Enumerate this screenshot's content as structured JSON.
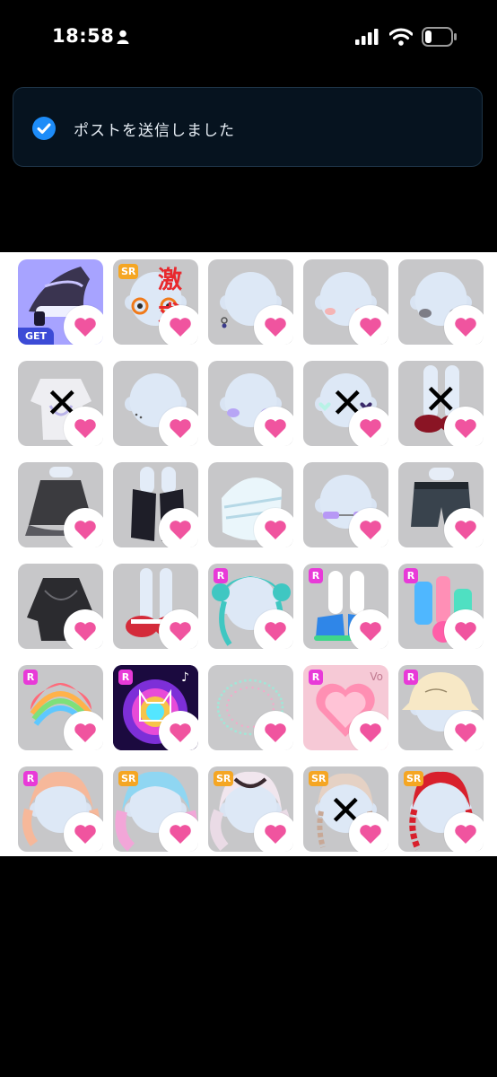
{
  "status_bar": {
    "time": "18:58",
    "icons": [
      "person-icon",
      "signal-icon",
      "wifi-icon",
      "battery-icon"
    ]
  },
  "toast": {
    "message": "ポストを送信しました",
    "icon": "check-circle-icon",
    "accent": "#1d8cf8"
  },
  "colors": {
    "heart": "#f0549f",
    "rarity_r": "#e83ad8",
    "rarity_sr": "#f5a623"
  },
  "items": [
    {
      "kind": "hat-icon",
      "badge": "GET"
    },
    {
      "kind": "face-glasses-icon",
      "rarity": "SR",
      "note": "激求"
    },
    {
      "kind": "face-earring-icon"
    },
    {
      "kind": "face-blush-icon"
    },
    {
      "kind": "face-shadow-icon"
    },
    {
      "kind": "shirt-icon",
      "crossed": true
    },
    {
      "kind": "face-freckles-icon"
    },
    {
      "kind": "face-purple-blush-icon"
    },
    {
      "kind": "face-hearts-icon",
      "crossed": true
    },
    {
      "kind": "shoes-icon",
      "crossed": true
    },
    {
      "kind": "skirt-icon"
    },
    {
      "kind": "legwarmer-icon"
    },
    {
      "kind": "bandage-icon"
    },
    {
      "kind": "face-purple-glasses-icon"
    },
    {
      "kind": "shorts-icon"
    },
    {
      "kind": "lace-top-icon"
    },
    {
      "kind": "red-shoes-icon"
    },
    {
      "kind": "twintail-hair-icon",
      "rarity": "R"
    },
    {
      "kind": "blue-sneakers-icon",
      "rarity": "R"
    },
    {
      "kind": "bottles-icon",
      "rarity": "R"
    },
    {
      "kind": "rainbow-hair-icon",
      "rarity": "R"
    },
    {
      "kind": "neon-cat-background-icon",
      "rarity": "R"
    },
    {
      "kind": "sparkle-frame-icon"
    },
    {
      "kind": "heart-background-icon",
      "rarity": "R",
      "label": "Vo"
    },
    {
      "kind": "bucket-hat-icon",
      "rarity": "R"
    },
    {
      "kind": "peach-hair-icon",
      "rarity": "R"
    },
    {
      "kind": "pastel-hair-icon",
      "rarity": "SR"
    },
    {
      "kind": "wavy-hair-icon",
      "rarity": "SR"
    },
    {
      "kind": "braided-hair-icon",
      "rarity": "SR",
      "crossed": true
    },
    {
      "kind": "red-braid-hair-icon",
      "rarity": "SR"
    }
  ]
}
